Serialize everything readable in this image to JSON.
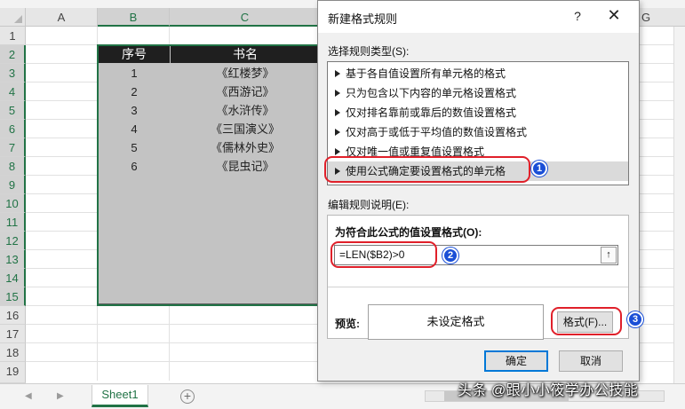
{
  "spreadsheet": {
    "columns": [
      "A",
      "B",
      "C",
      "G"
    ],
    "rows": [
      "1",
      "2",
      "3",
      "4",
      "5",
      "6",
      "7",
      "8",
      "9",
      "10",
      "11",
      "12",
      "13",
      "14",
      "15",
      "16",
      "17",
      "18",
      "19"
    ],
    "table_header": {
      "col_b": "序号",
      "col_c": "书名"
    },
    "table_rows": [
      {
        "num": "1",
        "title": "《红楼梦》"
      },
      {
        "num": "2",
        "title": "《西游记》"
      },
      {
        "num": "3",
        "title": "《水浒传》"
      },
      {
        "num": "4",
        "title": "《三国演义》"
      },
      {
        "num": "5",
        "title": "《儒林外史》"
      },
      {
        "num": "6",
        "title": "《昆虫记》"
      }
    ],
    "sheet_tab": "Sheet1",
    "add_sheet": "+",
    "tab_prev": "◀",
    "tab_next": "▶"
  },
  "dialog": {
    "title": "新建格式规则",
    "help": "?",
    "close": "✕",
    "select_rule_type_label": "选择规则类型(S):",
    "rule_types": [
      "基于各自值设置所有单元格的格式",
      "只为包含以下内容的单元格设置格式",
      "仅对排名靠前或靠后的数值设置格式",
      "仅对高于或低于平均值的数值设置格式",
      "仅对唯一值或重复值设置格式",
      "使用公式确定要设置格式的单元格"
    ],
    "selected_rule_index": 5,
    "edit_rule_label": "编辑规则说明(E):",
    "formula_label": "为符合此公式的值设置格式(O):",
    "formula_value": "=LEN($B2)>0",
    "collapse_icon": "↑",
    "preview_label": "预览:",
    "preview_text": "未设定格式",
    "format_button": "格式(F)...",
    "ok_button": "确定",
    "cancel_button": "取消"
  },
  "annotations": {
    "badge_1": "1",
    "badge_2": "2",
    "badge_3": "3",
    "color": "#e0202a",
    "badge_color": "#1a4fd6"
  },
  "watermark": "头条 @跟小小筱学办公技能",
  "colors": {
    "excel_green": "#217346",
    "header_black": "#1f1f1f",
    "range_gray": "#c3c3c3",
    "dialog_bg": "#f0f0f0",
    "accent_blue": "#0078d7"
  }
}
